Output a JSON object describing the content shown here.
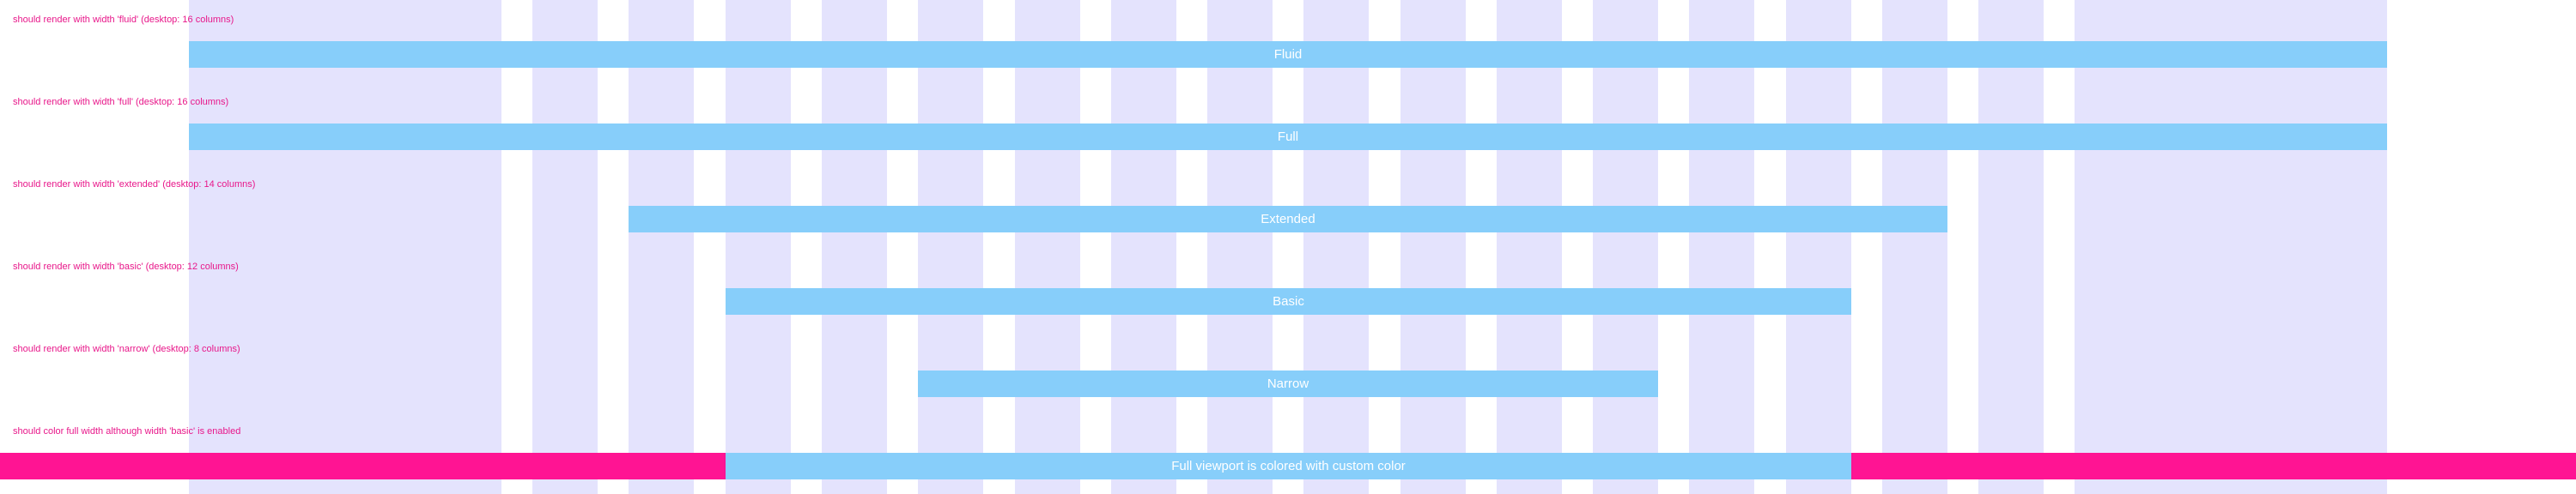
{
  "stories": [
    {
      "label": "should render with width 'fluid' (desktop: 16 columns)",
      "bar_text": "Fluid",
      "width_mode": "fluid",
      "desktop_columns": 16
    },
    {
      "label": "should render with width 'full' (desktop: 16 columns)",
      "bar_text": "Full",
      "width_mode": "full",
      "desktop_columns": 16
    },
    {
      "label": "should render with width 'extended' (desktop: 14 columns)",
      "bar_text": "Extended",
      "width_mode": "extended",
      "desktop_columns": 14
    },
    {
      "label": "should render with width 'basic' (desktop: 12 columns)",
      "bar_text": "Basic",
      "width_mode": "basic",
      "desktop_columns": 12
    },
    {
      "label": "should render with width 'narrow' (desktop: 8 columns)",
      "bar_text": "Narrow",
      "width_mode": "narrow",
      "desktop_columns": 8
    },
    {
      "label": "should color full width although width 'basic' is enabled",
      "bar_text": "Full viewport is colored with custom color",
      "width_mode": "basic",
      "desktop_columns": 12
    }
  ],
  "colors": {
    "grid_column": "#e4e3fd",
    "bar": "#87cefa",
    "bar_text": "#ffffff",
    "label_text": "#e8178a",
    "custom_band": "#ff1493"
  }
}
